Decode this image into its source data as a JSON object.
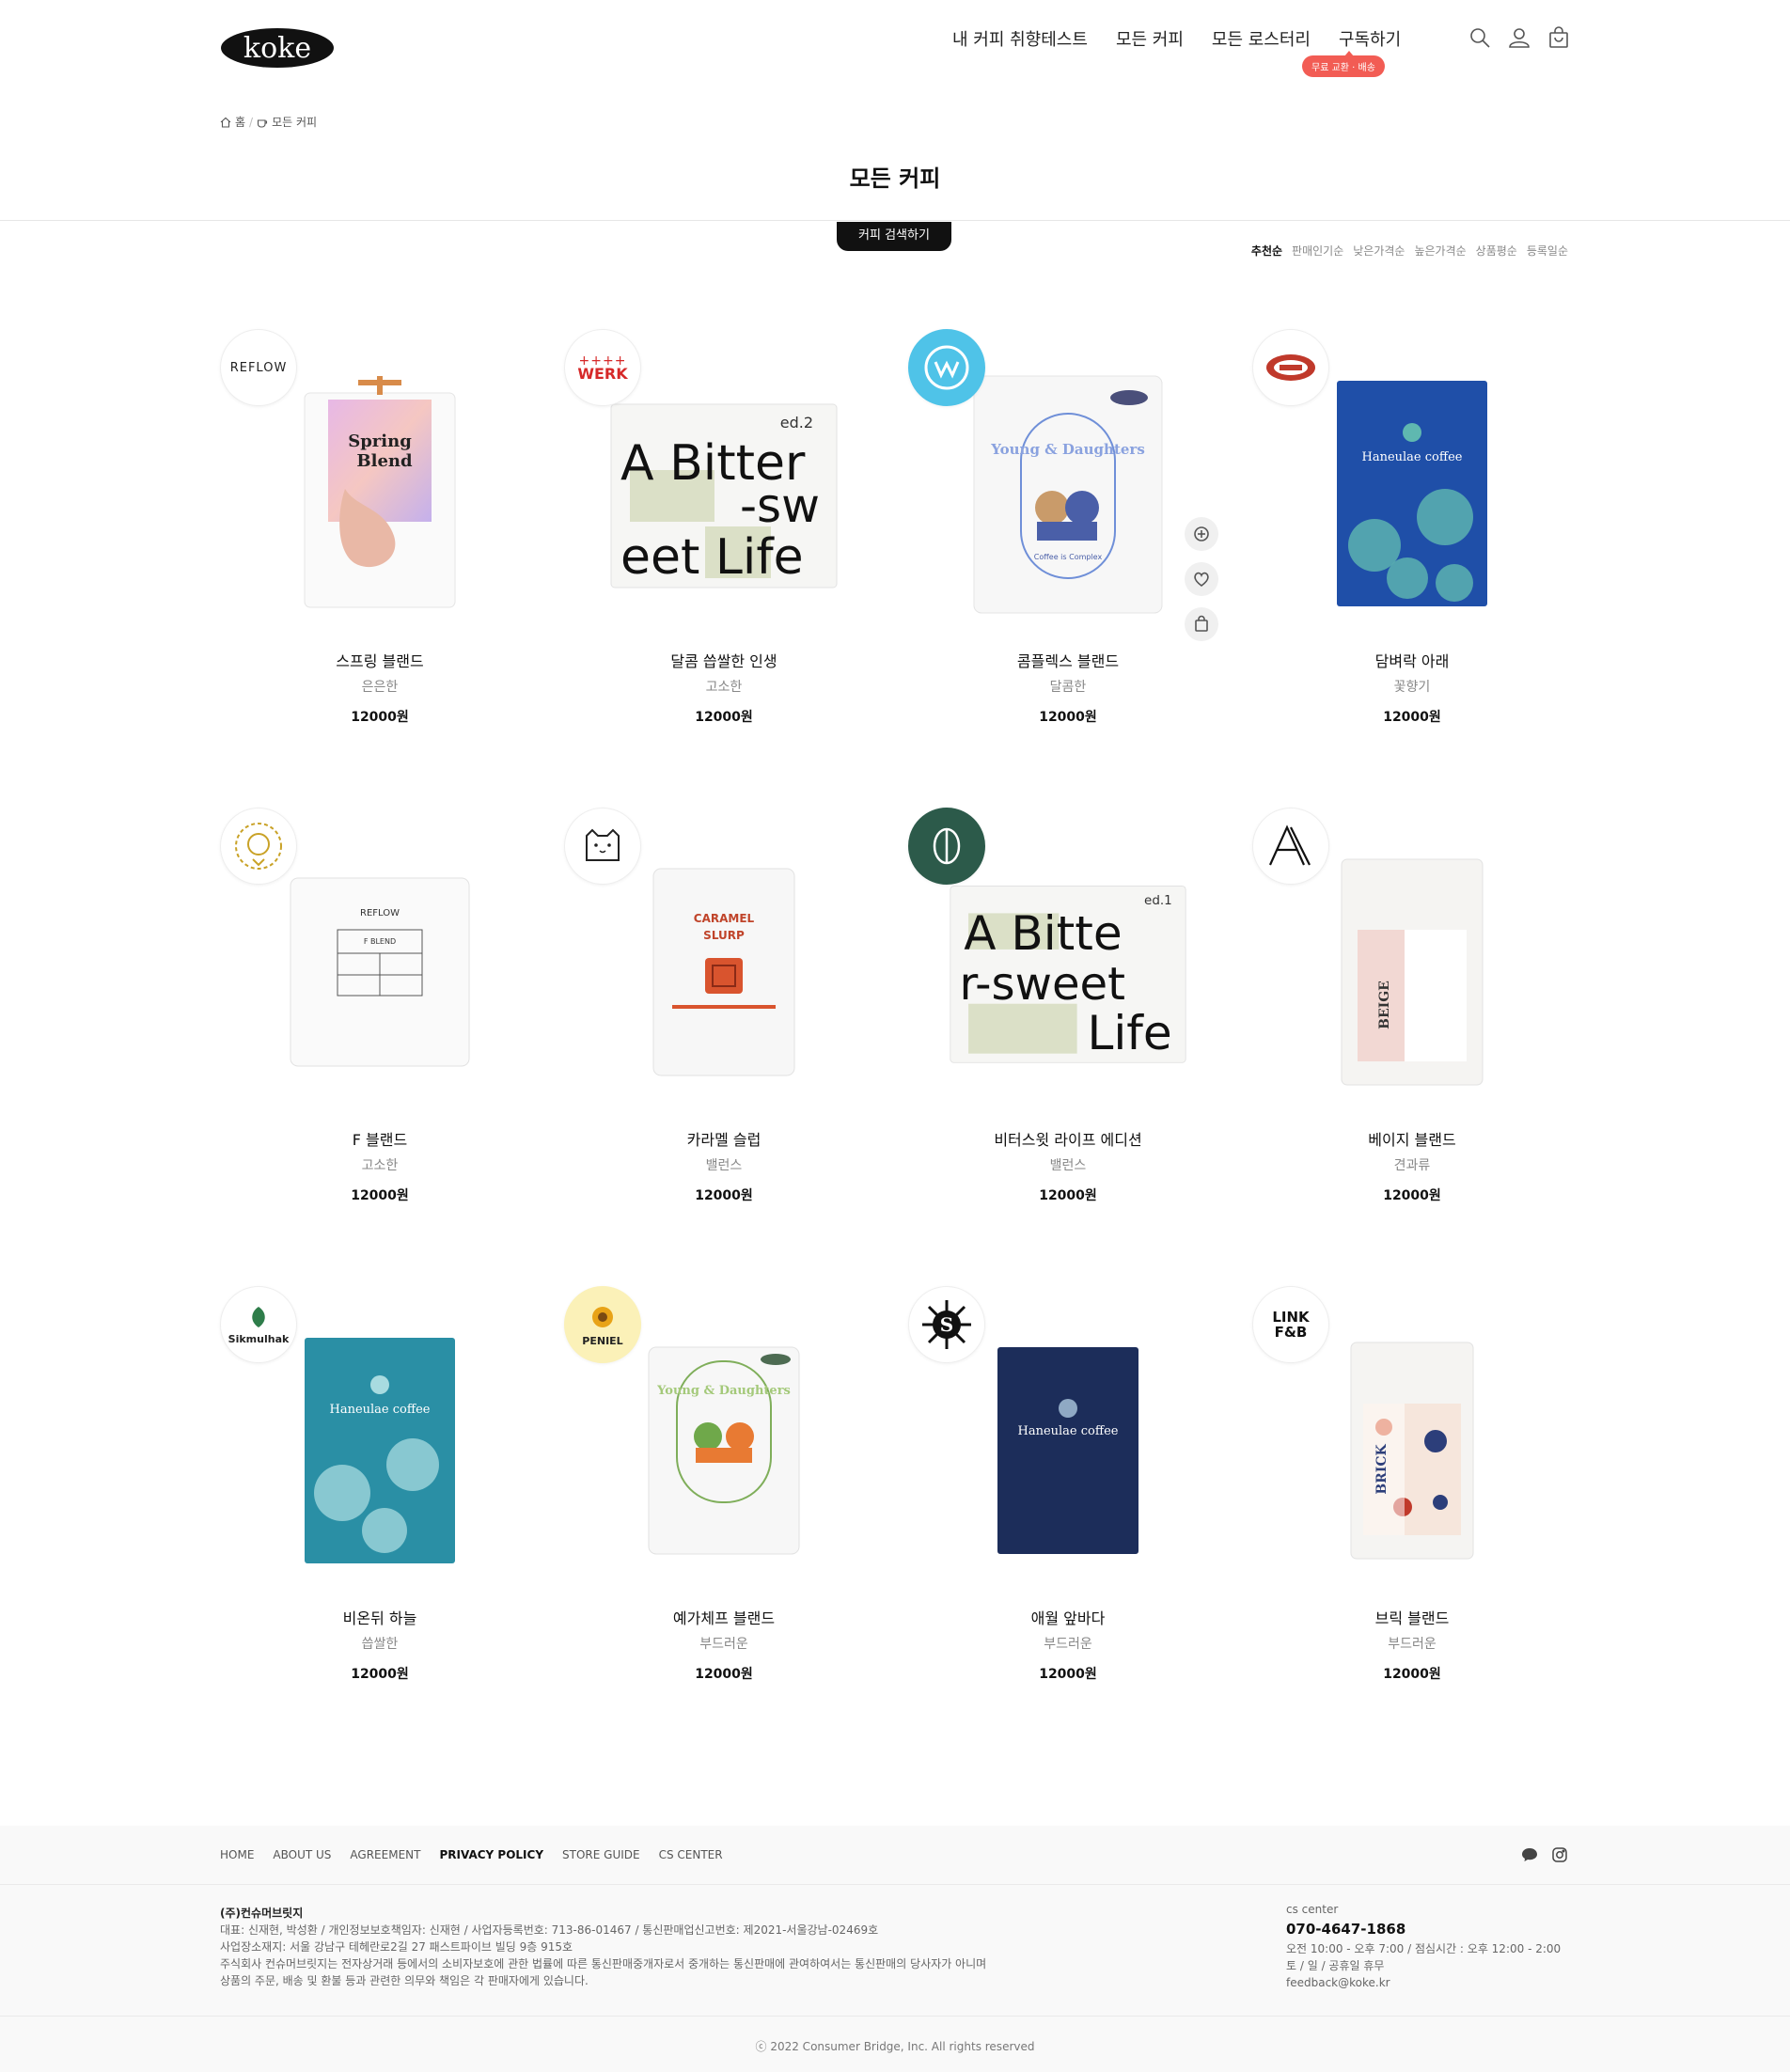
{
  "header": {
    "logo_text": "koke",
    "nav": [
      "내 커피 취향테스트",
      "모든 커피",
      "모든 로스터리",
      "구독하기"
    ],
    "subscribe_badge": "무료 교환 · 배송"
  },
  "breadcrumb": {
    "home": "홈",
    "sep": "/",
    "current": "모든 커피"
  },
  "page_title": "모든 커피",
  "search_tab": "커피 검색하기",
  "sort": {
    "options": [
      "추천순",
      "판매인기순",
      "낮은가격순",
      "높은가격순",
      "상품평순",
      "등록일순"
    ],
    "active": "추천순"
  },
  "products": [
    {
      "name": "스프링 블랜드",
      "taste": "은은한",
      "price": "12000원",
      "roaster": "REFLOW",
      "pkg": "spring"
    },
    {
      "name": "달콤 씁쌀한 인생",
      "taste": "고소한",
      "price": "12000원",
      "roaster": "WERK",
      "pkg": "bitter"
    },
    {
      "name": "콤플렉스 블랜드",
      "taste": "달콤한",
      "price": "12000원",
      "roaster": "",
      "pkg": "complex"
    },
    {
      "name": "담벼락 아래",
      "taste": "꽃향기",
      "price": "12000원",
      "roaster": "",
      "pkg": "haneulae-blue"
    },
    {
      "name": "F 블랜드",
      "taste": "고소한",
      "price": "12000원",
      "roaster": "",
      "pkg": "fblend"
    },
    {
      "name": "카라멜 슬럽",
      "taste": "밸런스",
      "price": "12000원",
      "roaster": "",
      "pkg": "caramel"
    },
    {
      "name": "비터스윗 라이프 에디션",
      "taste": "밸런스",
      "price": "12000원",
      "roaster": "",
      "pkg": "bitter2"
    },
    {
      "name": "베이지 블랜드",
      "taste": "견과류",
      "price": "12000원",
      "roaster": "",
      "pkg": "beige"
    },
    {
      "name": "비온뒤 하늘",
      "taste": "씁쌀한",
      "price": "12000원",
      "roaster": "Sikmulhak",
      "pkg": "haneulae-teal"
    },
    {
      "name": "예가체프 블랜드",
      "taste": "부드러운",
      "price": "12000원",
      "roaster": "PENIEL",
      "pkg": "yirga"
    },
    {
      "name": "애월 앞바다",
      "taste": "부드러운",
      "price": "12000원",
      "roaster": "S",
      "pkg": "haneulae-navy"
    },
    {
      "name": "브릭 블랜드",
      "taste": "부드러운",
      "price": "12000원",
      "roaster": "LINK F&B",
      "pkg": "brick"
    }
  ],
  "package_text": {
    "spring": "Spring Blend",
    "bitter_1": "A Bitter",
    "bitter_2": "-sw",
    "bitter_3": "eet Life",
    "bitter_ed": "ed.2",
    "complex": "Young & Daughters",
    "complex_sub": "Coffee is Complex",
    "haneulae": "Haneulae coffee",
    "fblend_brand": "REFLOW",
    "fblend_name": "F BLEND",
    "caramel": "CARAMEL SLURP",
    "bitter2_1": "A Bitte",
    "bitter2_2": "r-sweet",
    "bitter2_3": "Life",
    "bitter2_ed": "ed.1",
    "beige": "BEIGE",
    "brick": "BRICK",
    "yirga": "Young & Daughters"
  },
  "colors": {
    "accent": "#f25c54",
    "dark": "#111111",
    "blue_pkg": "#1f4fa8",
    "teal_pkg": "#2a8fa5",
    "navy_pkg": "#1c2d5a"
  },
  "footer": {
    "nav": [
      "HOME",
      "ABOUT US",
      "AGREEMENT",
      "PRIVACY POLICY",
      "STORE GUIDE",
      "CS CENTER"
    ],
    "company": "(주)컨슈머브릿지",
    "info": [
      "대표: 신재현, 박성환 / 개인정보보호책임자: 신재현 / 사업자등록번호: 713-86-01467 / 통신판매업신고번호: 제2021-서울강남-02469호",
      "사업장소재지: 서울 강남구 테헤란로2길 27 패스트파이브 빌딩 9층 915호",
      "주식회사 컨슈머브릿지는 전자상거래 등에서의 소비자보호에 관한 법률에 따른 통신판매중개자로서 중개하는 통신판매에 관여하여서는 통신판매의 당사자가 아니며",
      "상품의 주문, 배송 및 환불 등과 관련한 의무와 책임은 각 판매자에게 있습니다."
    ],
    "cs_label": "cs center",
    "cs_phone": "070-4647-1868",
    "cs_hours": "오전 10:00 - 오후 7:00 / 점심시간 : 오후 12:00 - 2:00",
    "cs_holiday": "토 / 일 / 공휴일 휴무",
    "cs_email": "feedback@koke.kr",
    "copyright": "ⓒ 2022 Consumer Bridge, Inc. All rights reserved"
  }
}
